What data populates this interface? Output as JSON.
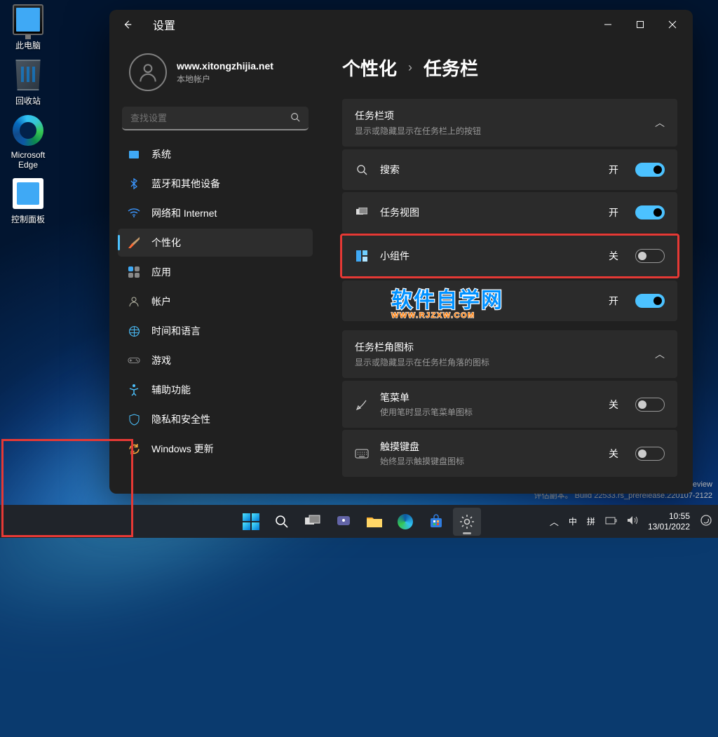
{
  "desktop": {
    "icons": [
      "此电脑",
      "回收站",
      "Microsoft Edge",
      "控制面板"
    ]
  },
  "window": {
    "title": "设置",
    "profile": {
      "name": "www.xitongzhijia.net",
      "account": "本地帐户"
    },
    "search_placeholder": "查找设置",
    "nav": [
      "系统",
      "蓝牙和其他设备",
      "网络和 Internet",
      "个性化",
      "应用",
      "帐户",
      "时间和语言",
      "游戏",
      "辅助功能",
      "隐私和安全性",
      "Windows 更新"
    ],
    "nav_active_index": 3,
    "breadcrumb": [
      "个性化",
      "任务栏"
    ],
    "section1": {
      "title": "任务栏项",
      "sub": "显示或隐藏显示在任务栏上的按钮"
    },
    "rows1": [
      {
        "label": "搜索",
        "state": "开",
        "on": true
      },
      {
        "label": "任务视图",
        "state": "开",
        "on": true
      },
      {
        "label": "小组件",
        "state": "关",
        "on": false
      },
      {
        "label": "",
        "state": "开",
        "on": true
      }
    ],
    "section2": {
      "title": "任务栏角图标",
      "sub": "显示或隐藏显示在任务栏角落的图标"
    },
    "rows2": [
      {
        "label": "笔菜单",
        "sub": "使用笔时显示笔菜单图标",
        "state": "关",
        "on": false
      },
      {
        "label": "触摸键盘",
        "sub": "始终显示触摸键盘图标",
        "state": "关",
        "on": false
      }
    ]
  },
  "watermark": {
    "main": "软件自学网",
    "sub": "WWW.RJZXW.COM"
  },
  "build": {
    "line1": "eview",
    "line2": "评估副本。 Build 22533.rs_prerelease.220107-2122"
  },
  "tray": {
    "ime1": "中",
    "ime2": "拼",
    "time": "10:55",
    "date": "13/01/2022"
  }
}
